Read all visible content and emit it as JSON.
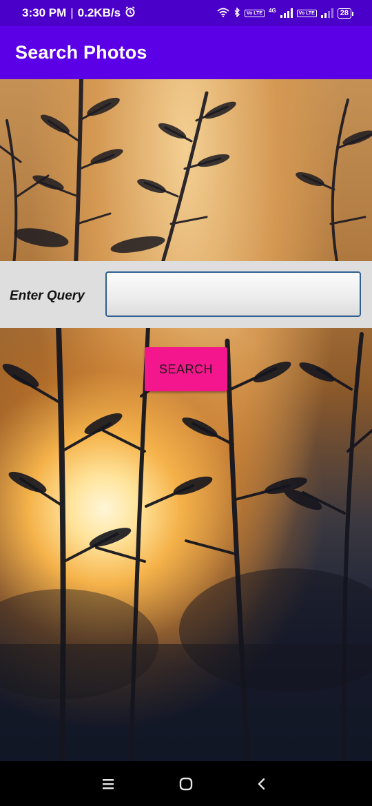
{
  "status_bar": {
    "time": "3:30 PM",
    "separator": "|",
    "data_rate": "0.2KB/s",
    "network": "4G",
    "lte_label_1": "Vo LTE",
    "lte_label_2": "Vo LTE",
    "battery": "28",
    "icons": [
      "alarm-icon",
      "wifi-icon",
      "bluetooth-icon",
      "signal-icon",
      "battery-icon"
    ]
  },
  "app_bar": {
    "title": "Search Photos"
  },
  "form": {
    "label": "Enter Query",
    "input_value": "",
    "input_placeholder": ""
  },
  "search_button": {
    "label": "SEARCH"
  },
  "nav_bar": {
    "icons": [
      "menu-icon",
      "home-icon",
      "back-icon"
    ]
  },
  "colors": {
    "status_bar": "#4a00c8",
    "app_bar": "#5b00e6",
    "form_panel": "#dedede",
    "button": "#f4168c",
    "input_border": "#2f5f8f"
  }
}
